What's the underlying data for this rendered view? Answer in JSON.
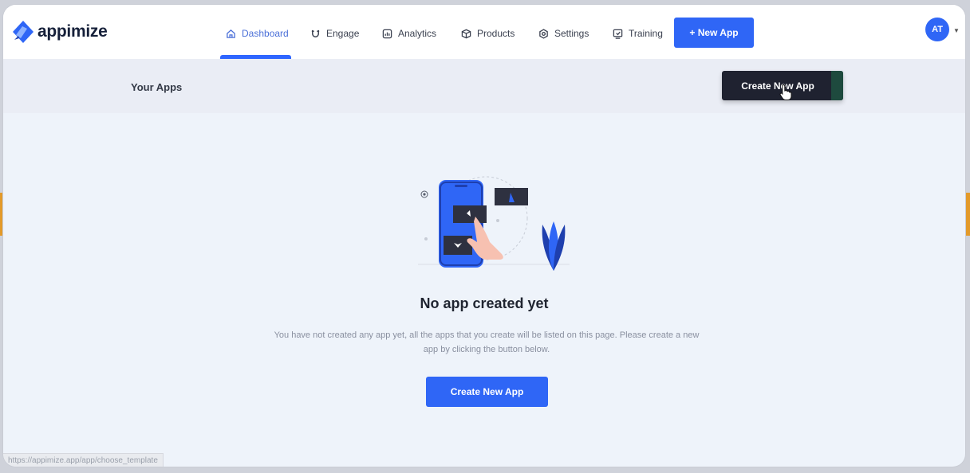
{
  "brand": {
    "name": "appimize",
    "color": "#2f66f6"
  },
  "nav": {
    "items": [
      {
        "label": "Dashboard",
        "icon": "home-icon",
        "active": true
      },
      {
        "label": "Engage",
        "icon": "magnet-icon"
      },
      {
        "label": "Analytics",
        "icon": "analytics-icon"
      },
      {
        "label": "Products",
        "icon": "box-icon"
      },
      {
        "label": "Settings",
        "icon": "gear-icon"
      },
      {
        "label": "Training",
        "icon": "training-icon"
      }
    ],
    "new_app_label": "+ New App",
    "avatar_initials": "AT"
  },
  "subheader": {
    "title": "Your Apps",
    "create_label": "Create New App"
  },
  "empty_state": {
    "title": "No app created yet",
    "description": "You have not created any app yet, all the apps that you create will be listed on this page. Please create a new app by clicking the button below.",
    "button_label": "Create New App"
  },
  "status_bar": {
    "url": "https://appimize.app/app/choose_template"
  }
}
